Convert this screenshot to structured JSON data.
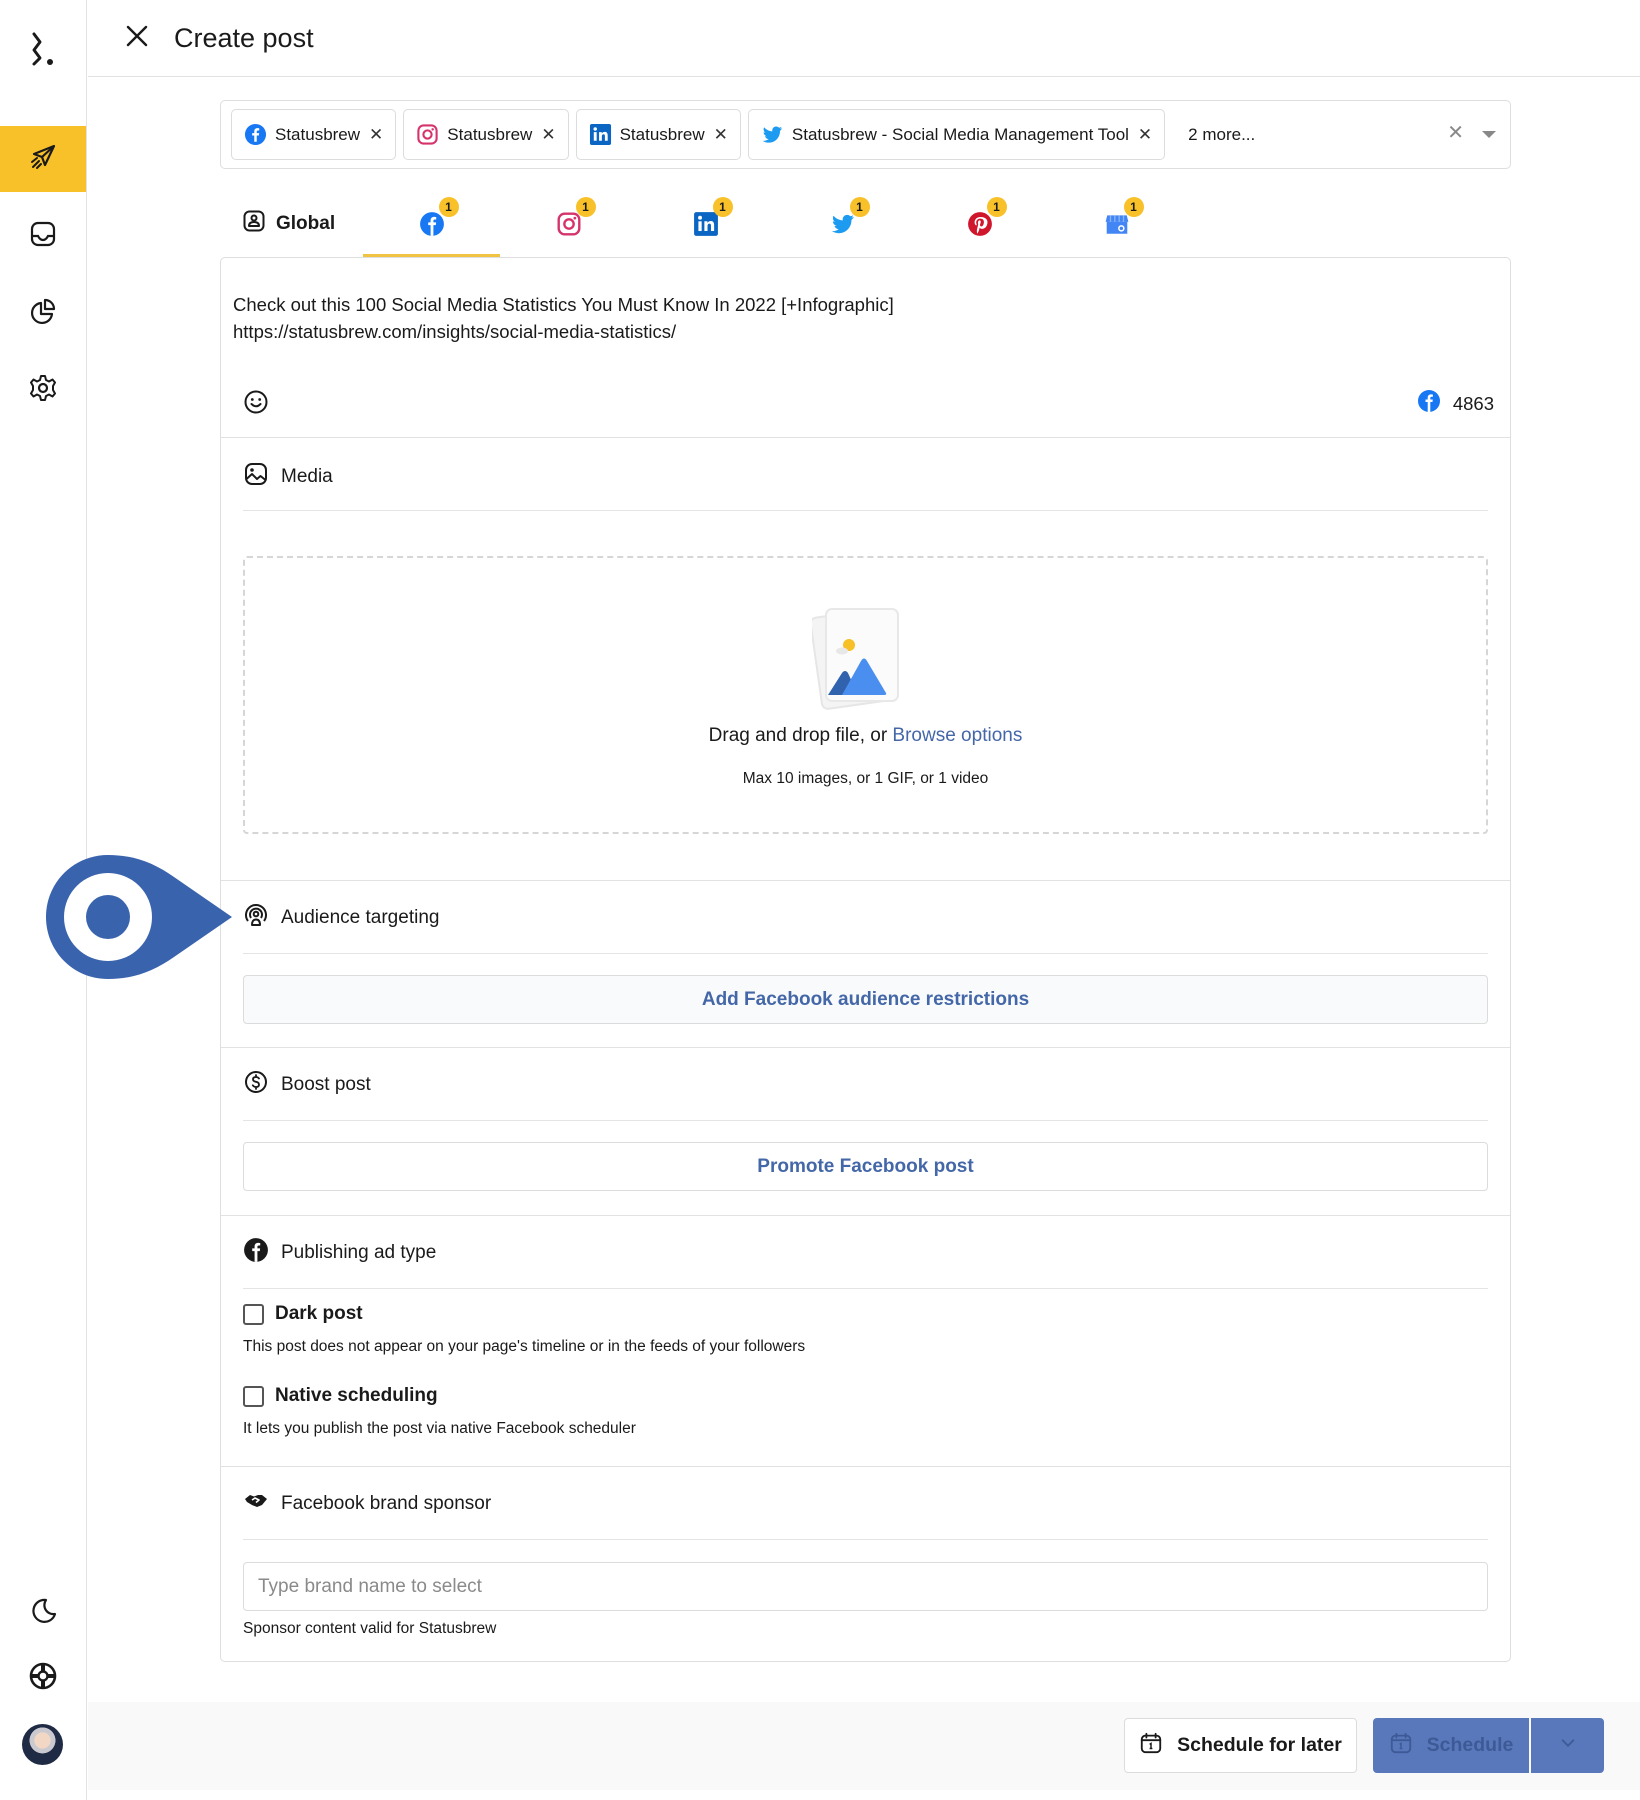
{
  "header": {
    "title": "Create post",
    "close_icon": "close-icon"
  },
  "sidebar": {
    "logo": "statusbrew-logo",
    "items": [
      {
        "id": "publish",
        "icon": "paper-plane-icon",
        "active": true
      },
      {
        "id": "inbox",
        "icon": "inbox-icon",
        "active": false
      },
      {
        "id": "reports",
        "icon": "pie-chart-icon",
        "active": false
      },
      {
        "id": "settings",
        "icon": "gear-icon",
        "active": false
      }
    ],
    "bottom_items": [
      {
        "id": "dark-mode",
        "icon": "moon-icon"
      },
      {
        "id": "help",
        "icon": "lifebuoy-icon"
      },
      {
        "id": "profile",
        "icon": "avatar"
      }
    ],
    "accent_color": "#f8c12a"
  },
  "account_selector": {
    "chips": [
      {
        "network": "facebook",
        "label": "Statusbrew"
      },
      {
        "network": "instagram",
        "label": "Statusbrew"
      },
      {
        "network": "linkedin",
        "label": "Statusbrew"
      },
      {
        "network": "twitter",
        "label": "Statusbrew - Social Media Management Tool"
      }
    ],
    "more_label": "2 more..."
  },
  "tabs": {
    "global_label": "Global",
    "networks": [
      {
        "network": "facebook",
        "badge": "1",
        "active": true
      },
      {
        "network": "instagram",
        "badge": "1",
        "active": false
      },
      {
        "network": "linkedin",
        "badge": "1",
        "active": false
      },
      {
        "network": "twitter",
        "badge": "1",
        "active": false
      },
      {
        "network": "pinterest",
        "badge": "1",
        "active": false
      },
      {
        "network": "google-business",
        "badge": "1",
        "active": false
      }
    ]
  },
  "composer": {
    "line1": "Check out this 100 Social Media Statistics You Must Know In 2022 [+Infographic]",
    "line2": "https://statusbrew.com/insights/social-media-statistics/",
    "char_count": "4863"
  },
  "media": {
    "title": "Media",
    "drop_text": "Drag and drop file, or ",
    "browse_link": "Browse options",
    "limits": "Max 10 images, or 1 GIF, or 1 video"
  },
  "audience": {
    "title": "Audience targeting",
    "button": "Add Facebook audience restrictions"
  },
  "boost": {
    "title": "Boost post",
    "button": "Promote Facebook post"
  },
  "publishing": {
    "title": "Publishing ad type",
    "options": [
      {
        "label": "Dark post",
        "desc": "This post does not appear on your page's timeline or in the feeds of your followers",
        "checked": false
      },
      {
        "label": "Native scheduling",
        "desc": "It lets you publish the post via native Facebook scheduler",
        "checked": false
      }
    ]
  },
  "sponsor": {
    "title": "Facebook brand sponsor",
    "placeholder": "Type brand name to select",
    "value": "",
    "note": "Sponsor content valid for Statusbrew"
  },
  "footer": {
    "schedule_later": "Schedule for later",
    "schedule": "Schedule"
  },
  "colors": {
    "link": "#4467a8",
    "primary_button": "#5978bb",
    "marker": "#3a63ae",
    "facebook": "#1877f2",
    "instagram": "#d6336c",
    "linkedin": "#0a66c2",
    "twitter": "#1d9bf0",
    "pinterest": "#d0162c"
  }
}
